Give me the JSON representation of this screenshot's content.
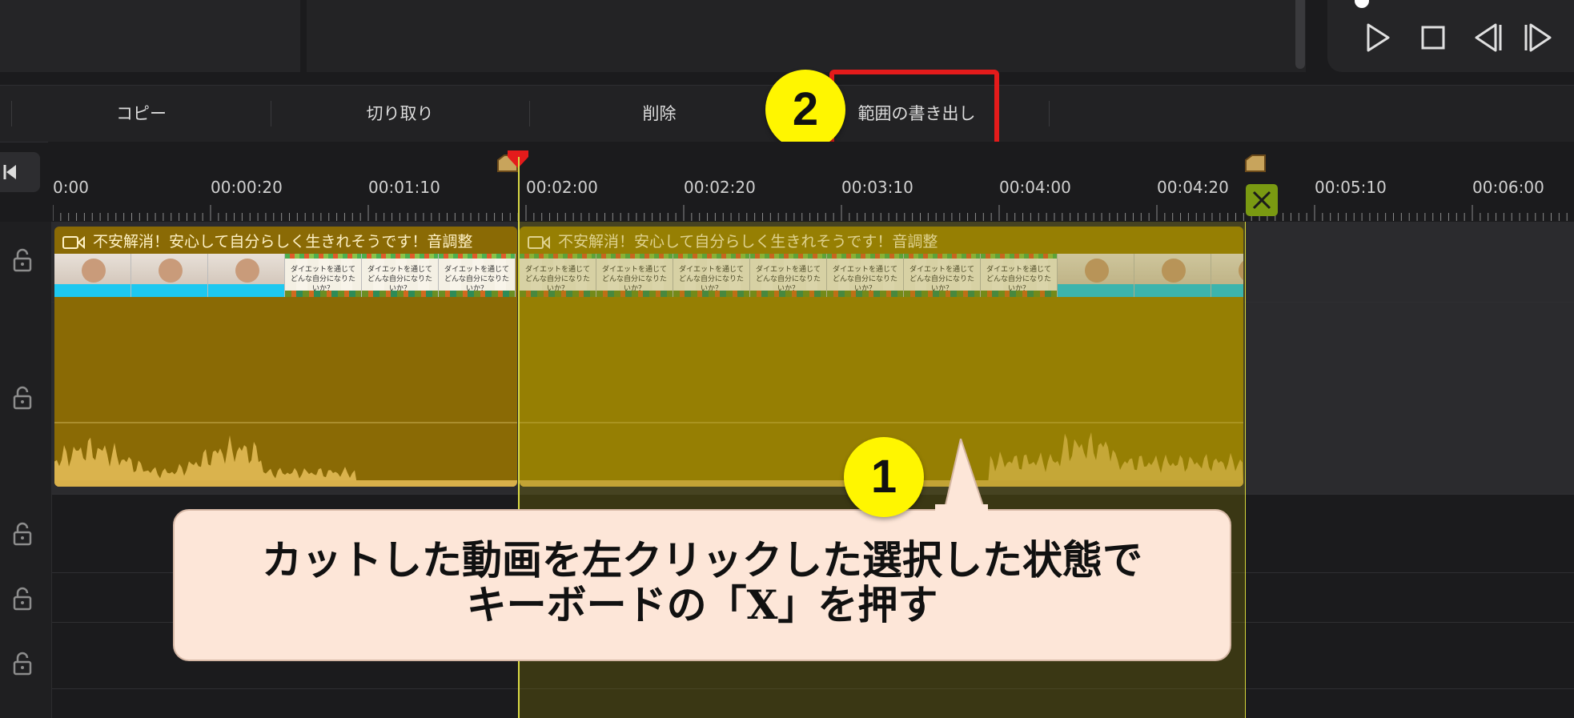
{
  "toolbar": {
    "copy_label": "コピー",
    "cut_label": "切り取り",
    "delete_label": "削除",
    "export_range_label": "範囲の書き出し"
  },
  "ruler": {
    "ticks": [
      "0:00",
      "00:00:20",
      "00:01:10",
      "00:02:00",
      "00:02:20",
      "00:03:10",
      "00:04:00",
      "00:04:20",
      "00:05:10",
      "00:06:00"
    ]
  },
  "clips": [
    {
      "title": "不安解消！安心して自分らしく生きれそうです！音調整",
      "color": "#8a6a05"
    },
    {
      "title": "不安解消！安心して自分らしく生きれそうです！音調整",
      "color": "#9a7e05"
    }
  ],
  "thumbnail_text": "ダイエットを通じて\nどんな自分になりたいか？",
  "annotations": {
    "step1": "1",
    "step2": "2",
    "callout_text": "カットした動画を左クリックした選択した状態で\nキーボードの「X」を押す"
  },
  "colors": {
    "accent_red": "#e41b1b",
    "badge_yellow": "#fff600",
    "playhead": "#e41b1b",
    "selection_line": "#d6d63a"
  },
  "icons": {
    "transport": [
      "play-icon",
      "stop-icon",
      "previous-frame-icon",
      "next-frame-icon"
    ],
    "track": "lock-icon",
    "clip": "video-camera-icon",
    "marker": "close-x-icon"
  }
}
